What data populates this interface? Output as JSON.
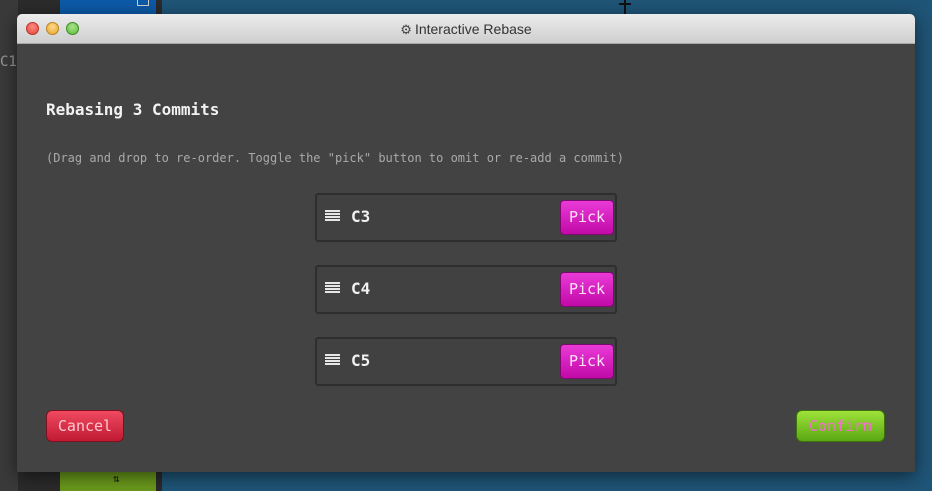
{
  "background": {
    "partial_label": "C1"
  },
  "window": {
    "title": "Interactive Rebase",
    "title_icon": "gear-icon"
  },
  "dialog": {
    "heading": "Rebasing 3 Commits",
    "hint": "(Drag and drop to re-order. Toggle the \"pick\" button to omit or re-add a commit)",
    "commits": [
      {
        "id": "C3",
        "action": "Pick"
      },
      {
        "id": "C4",
        "action": "Pick"
      },
      {
        "id": "C5",
        "action": "Pick"
      }
    ],
    "cancel_label": "Cancel",
    "confirm_label": "Confirm"
  },
  "colors": {
    "pick": "#d11fbd",
    "cancel": "#d8283f",
    "confirm": "#7cc626",
    "dialog_bg": "#434343",
    "desktop_bg": "#1f5578"
  }
}
